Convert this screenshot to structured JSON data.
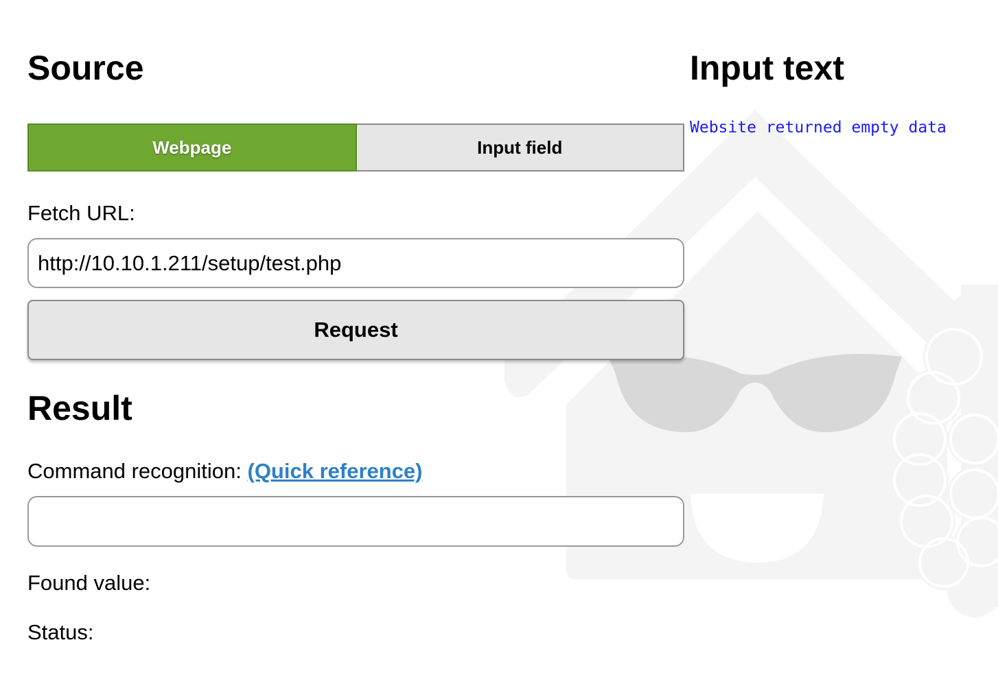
{
  "source": {
    "heading": "Source",
    "tabs": [
      {
        "label": "Webpage",
        "active": true
      },
      {
        "label": "Input field",
        "active": false
      }
    ],
    "fetch_label": "Fetch URL:",
    "url_value": "http://10.10.1.211/setup/test.php",
    "request_label": "Request"
  },
  "result": {
    "heading": "Result",
    "command_label": "Command recognition: ",
    "quick_reference": "(Quick reference)",
    "command_value": "",
    "found_label": "Found value:",
    "status_label": "Status:"
  },
  "input_text": {
    "heading": "Input text",
    "message": "Website returned empty data"
  },
  "colors": {
    "accent_green": "#6fa831",
    "link_blue": "#2f80c8",
    "message_blue": "#1a1aff",
    "button_gray": "#e6e6e6"
  }
}
